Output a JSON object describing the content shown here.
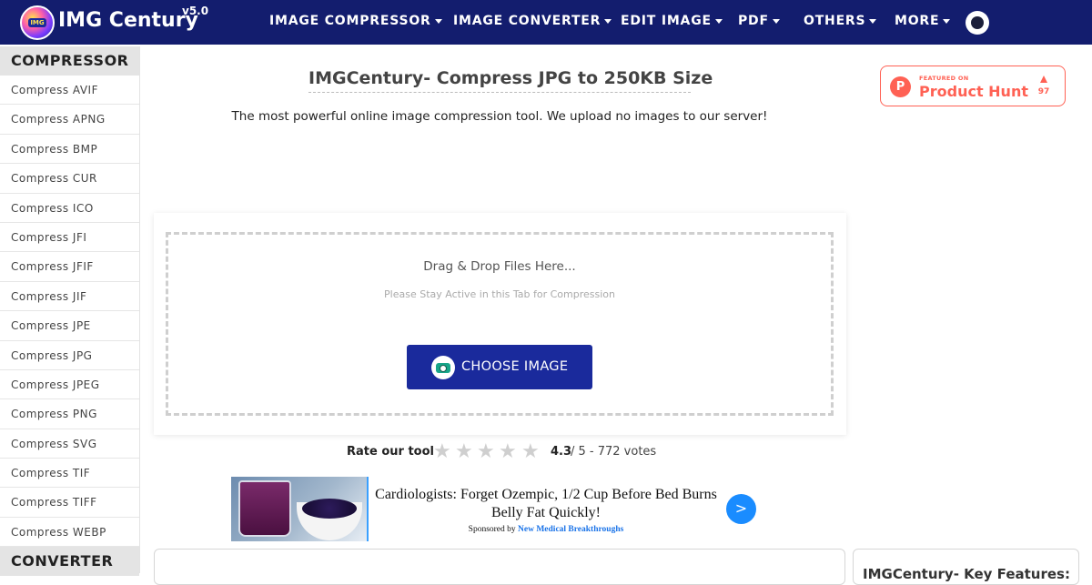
{
  "brand": {
    "name": "IMG Century",
    "version": "v5.0",
    "badge_text": "IMG"
  },
  "nav": {
    "items": [
      {
        "label": "IMAGE COMPRESSOR"
      },
      {
        "label": "IMAGE CONVERTER"
      },
      {
        "label": "EDIT IMAGE"
      },
      {
        "label": "PDF"
      },
      {
        "label": "OTHERS"
      },
      {
        "label": "MORE"
      }
    ]
  },
  "sidebar": {
    "section_compressor": "COMPRESSOR",
    "items": [
      "Compress AVIF",
      "Compress APNG",
      "Compress BMP",
      "Compress CUR",
      "Compress ICO",
      "Compress JFI",
      "Compress JFIF",
      "Compress JIF",
      "Compress JPE",
      "Compress JPG",
      "Compress JPEG",
      "Compress PNG",
      "Compress SVG",
      "Compress TIF",
      "Compress TIFF",
      "Compress WEBP"
    ],
    "section_converter": "CONVERTER"
  },
  "main": {
    "title": "IMGCentury- Compress JPG to 250KB Size",
    "subtitle": "The most powerful online image compression tool. We upload no images to our server!"
  },
  "product_hunt": {
    "featured": "FEATURED ON",
    "name": "Product Hunt",
    "count": "97",
    "logo_letter": "P"
  },
  "upload": {
    "drop_title": "Drag & Drop Files Here...",
    "drop_subtitle": "Please Stay Active in this Tab for Compression",
    "button_label": "CHOOSE IMAGE"
  },
  "rating": {
    "label": "Rate our tool",
    "score": "4.3",
    "rest": " / 5 - 772 votes",
    "stars_total": 5,
    "star_glyph": "★"
  },
  "ad": {
    "headline": "Cardiologists: Forget Ozempic, 1/2 Cup Before Bed Burns Belly Fat Quickly!",
    "sponsored_by": "Sponsored by",
    "sponsor": "New Medical Breakthroughs",
    "arrow": ">"
  },
  "bottom": {
    "key_features": "IMGCentury- Key Features:"
  },
  "colors": {
    "navbar": "#131d6e",
    "button": "#1a2a9c",
    "product_hunt": "#ff6154",
    "ad_arrow": "#1a8cff"
  }
}
